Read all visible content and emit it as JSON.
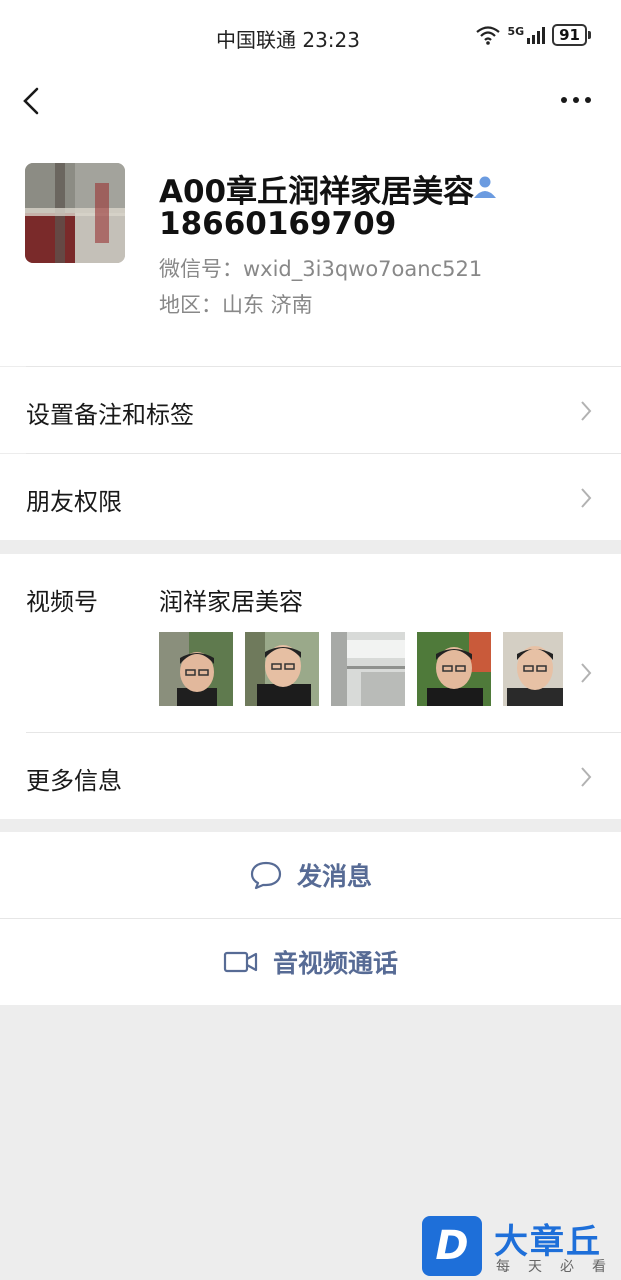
{
  "status_bar": {
    "carrier_time": "中国联通 23:23",
    "network": "5G",
    "battery": "91"
  },
  "profile": {
    "name": "A00章丘润祥家居美容",
    "phone": "18660169709",
    "wechat_id": "微信号：wxid_3i3qwo7oanc521",
    "region": "地区：山东  济南"
  },
  "menu": {
    "remarks_tags": "设置备注和标签",
    "friend_permissions": "朋友权限"
  },
  "channels": {
    "label": "视频号",
    "name": "润祥家居美容"
  },
  "more_info": "更多信息",
  "actions": {
    "send_message": "发消息",
    "voice_video_call": "音视频通话"
  },
  "watermark": {
    "title": "大章丘",
    "subtitle": "每天必看",
    "logo_letter": "D"
  },
  "colors": {
    "link_blue": "#576b95",
    "background": "#ededed",
    "watermark_blue": "#1e6fd9"
  }
}
